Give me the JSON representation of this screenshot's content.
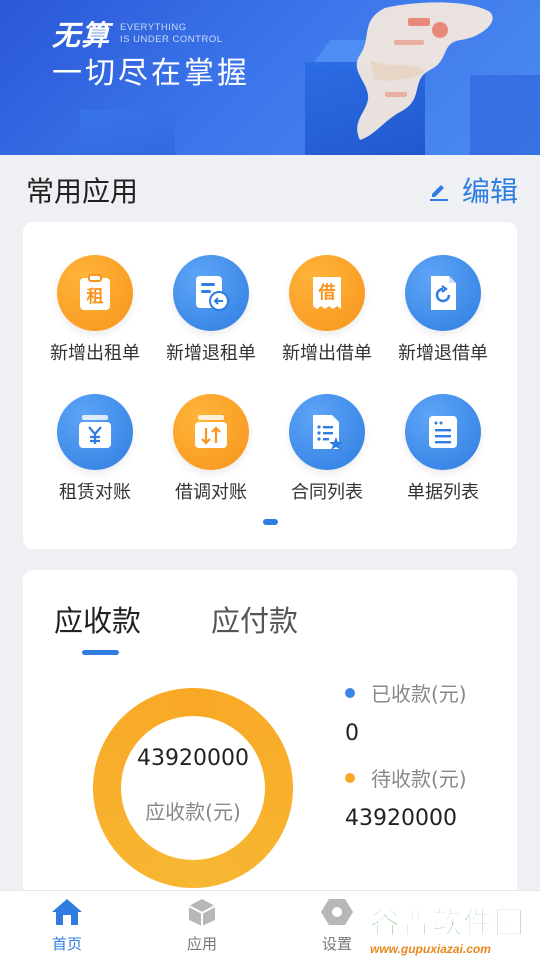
{
  "banner": {
    "logo": "无算",
    "subtitle_line1": "EVERYTHING",
    "subtitle_line2": "IS UNDER CONTROL",
    "slogan": "一切尽在掌握"
  },
  "apps_section": {
    "title": "常用应用",
    "edit_label": "编辑",
    "items": [
      {
        "label": "新增出租单",
        "icon": "rent-icon",
        "icon_text": "租",
        "color": "#f7941d"
      },
      {
        "label": "新增退租单",
        "icon": "return-rent-icon",
        "color": "#2f7de1"
      },
      {
        "label": "新增出借单",
        "icon": "lend-icon",
        "icon_text": "借",
        "color": "#f7941d"
      },
      {
        "label": "新增退借单",
        "icon": "return-lend-icon",
        "color": "#2f7de1"
      },
      {
        "label": "租赁对账",
        "icon": "yuan-ledger-icon",
        "color": "#2f7de1"
      },
      {
        "label": "借调对账",
        "icon": "transfer-icon",
        "color": "#f7941d"
      },
      {
        "label": "合同列表",
        "icon": "contract-list-icon",
        "color": "#2f7de1"
      },
      {
        "label": "单据列表",
        "icon": "document-list-icon",
        "color": "#2f7de1"
      }
    ]
  },
  "receivables": {
    "tabs": [
      "应收款",
      "应付款"
    ],
    "active_tab": "应收款",
    "donut_amount": "43920000",
    "donut_caption": "应收款(元)",
    "legend": [
      {
        "label": "已收款(元)",
        "value": "0",
        "color": "#3a86e8"
      },
      {
        "label": "待收款(元)",
        "value": "43920000",
        "color": "#f9a825"
      }
    ]
  },
  "tabbar": {
    "items": [
      {
        "label": "首页",
        "icon": "home-icon",
        "active": true
      },
      {
        "label": "应用",
        "icon": "cube-icon",
        "active": false
      },
      {
        "label": "设置",
        "icon": "hex-settings-icon",
        "active": false
      }
    ]
  },
  "watermark": {
    "title": "谷普软件园",
    "url": "www.gupuxiazai.com"
  }
}
